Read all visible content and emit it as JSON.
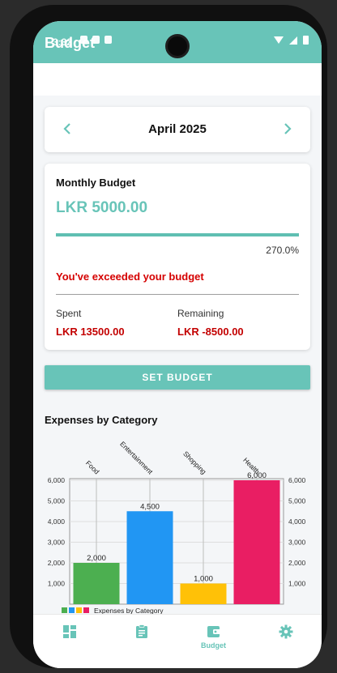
{
  "app": {
    "title": "Budget",
    "status_time": "3:32"
  },
  "month_selector": {
    "label": "April 2025",
    "prev_icon": "chevron-left-icon",
    "next_icon": "chevron-right-icon"
  },
  "budget": {
    "heading": "Monthly Budget",
    "amount": "LKR 5000.00",
    "progress_fraction": 1.0,
    "percent_text": "270.0%",
    "warning": "You've exceeded your budget",
    "spent_label": "Spent",
    "spent_value": "LKR 13500.00",
    "remaining_label": "Remaining",
    "remaining_value": "LKR -8500.00"
  },
  "actions": {
    "set_budget_label": "SET BUDGET"
  },
  "chart_section": {
    "title": "Expenses by Category"
  },
  "chart_data": {
    "type": "bar",
    "categories": [
      "Food",
      "Entertainment",
      "Shopping",
      "Health"
    ],
    "values": [
      2000,
      4500,
      1000,
      6000
    ],
    "colors": [
      "#4caf50",
      "#2196f3",
      "#ffc107",
      "#e91e63"
    ],
    "yticks": [
      1000,
      2000,
      3000,
      4000,
      5000,
      6000
    ],
    "ytick_labels": [
      "1,000",
      "2,000",
      "3,000",
      "4,000",
      "5,000",
      "6,000"
    ],
    "value_labels": [
      "2,000",
      "4,500",
      "1,000",
      "6,000"
    ],
    "ylim": [
      0,
      6000
    ],
    "legend": "Expenses by Category",
    "legend_position": "bottom-left",
    "grid": true
  },
  "colors": {
    "accent": "#68c4b8",
    "danger": "#d50000"
  },
  "nav": [
    {
      "name": "dashboard",
      "icon": "dashboard-icon",
      "label": ""
    },
    {
      "name": "transactions",
      "icon": "clipboard-icon",
      "label": ""
    },
    {
      "name": "budget",
      "icon": "wallet-icon",
      "label": "Budget"
    },
    {
      "name": "settings",
      "icon": "gear-icon",
      "label": ""
    }
  ]
}
